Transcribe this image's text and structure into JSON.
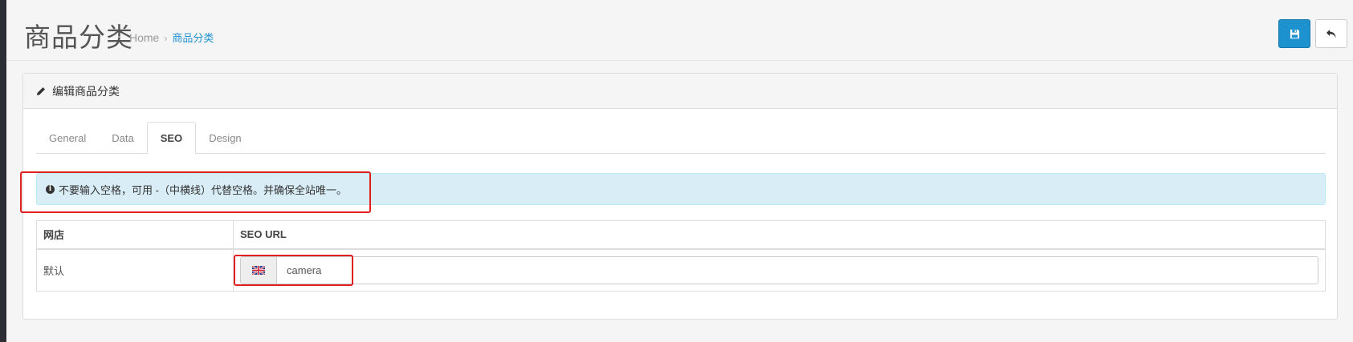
{
  "header": {
    "title": "商品分类",
    "breadcrumb": {
      "home": "Home",
      "separator": "›",
      "current": "商品分类"
    }
  },
  "toolbar": {
    "save_icon": "floppy-disk-icon",
    "back_icon": "reply-arrow-icon"
  },
  "panel": {
    "heading": "编辑商品分类",
    "heading_icon": "pencil-icon",
    "tabs": [
      {
        "label": "General",
        "active": false
      },
      {
        "label": "Data",
        "active": false
      },
      {
        "label": "SEO",
        "active": true
      },
      {
        "label": "Design",
        "active": false
      }
    ],
    "alert": {
      "icon": "info-circle-icon",
      "text": "不要输入空格，可用 -（中横线）代替空格。并确保全站唯一。"
    },
    "table": {
      "headers": [
        "网店",
        "SEO URL"
      ],
      "rows": [
        {
          "store": "默认",
          "flag_icon": "uk-flag-icon",
          "seo_url": "camera"
        }
      ]
    }
  },
  "colors": {
    "primary": "#1e91cf",
    "alert_bg": "#d9edf7",
    "highlight": "#e02020"
  }
}
